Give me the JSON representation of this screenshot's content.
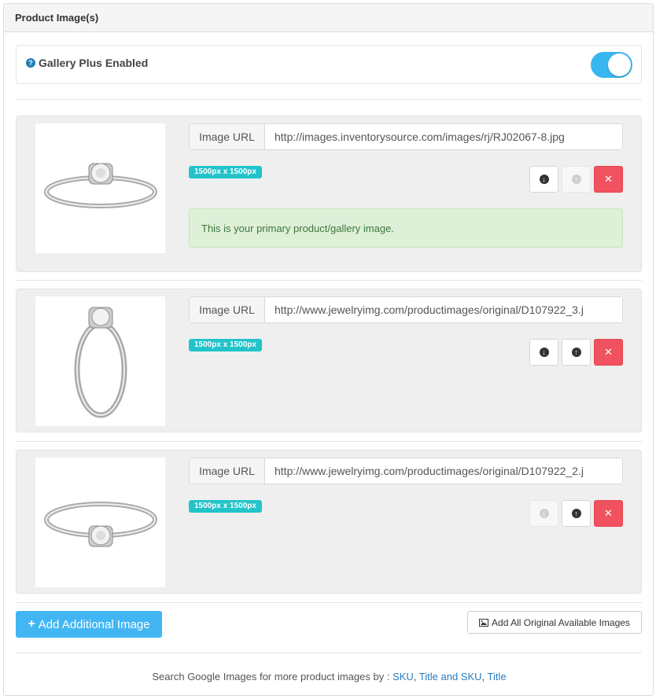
{
  "panel": {
    "title": "Product Image(s)"
  },
  "gallery": {
    "help_icon": "question-circle-icon",
    "label": "Gallery Plus Enabled",
    "enabled": true
  },
  "images": [
    {
      "url_label": "Image URL",
      "url": "http://images.inventorysource.com/images/rj/RJ02067-8.jpg",
      "size": "1500px x 1500px",
      "primary_msg": "This is your primary product/gallery image.",
      "down_disabled": false,
      "up_disabled": true
    },
    {
      "url_label": "Image URL",
      "url": "http://www.jewelryimg.com/productimages/original/D107922_3.j",
      "size": "1500px x 1500px",
      "down_disabled": false,
      "up_disabled": false
    },
    {
      "url_label": "Image URL",
      "url": "http://www.jewelryimg.com/productimages/original/D107922_2.j",
      "size": "1500px x 1500px",
      "down_disabled": true,
      "up_disabled": false
    }
  ],
  "actions": {
    "add_image": "Add Additional Image",
    "add_all": "Add All Original Available Images"
  },
  "footer": {
    "text": "Search Google Images for more product images by :",
    "links": [
      "SKU",
      "Title and SKU",
      "Title"
    ]
  },
  "colors": {
    "accent": "#41b6f2",
    "toggle": "#38b6f0",
    "danger": "#f0525f",
    "badge": "#22c3c9"
  }
}
